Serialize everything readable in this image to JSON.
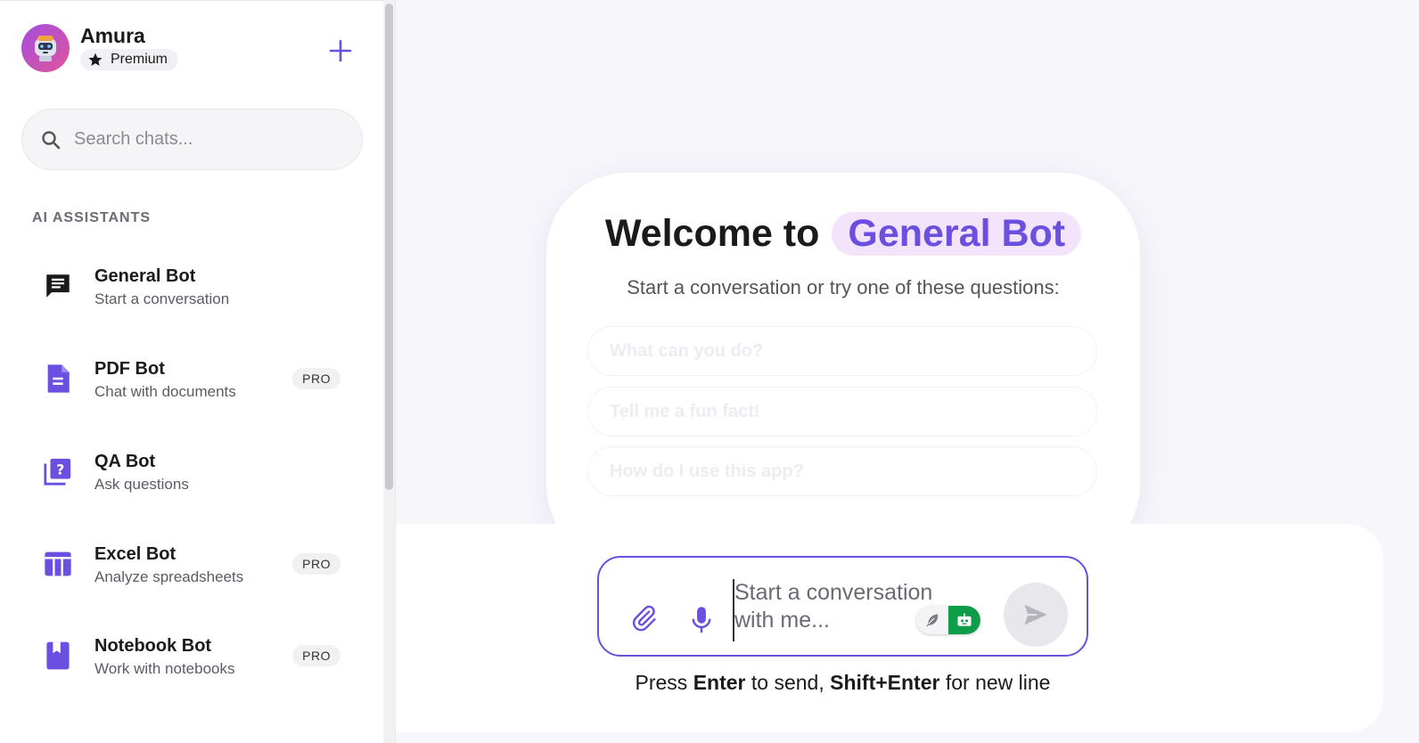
{
  "profile": {
    "name": "Amura",
    "plan": "Premium"
  },
  "search": {
    "placeholder": "Search chats..."
  },
  "assistants_section": {
    "title": "AI ASSISTANTS"
  },
  "assistants": [
    {
      "name": "General Bot",
      "description": "Start a conversation",
      "badge": "",
      "icon": "chat-icon"
    },
    {
      "name": "PDF Bot",
      "description": "Chat with documents",
      "badge": "PRO",
      "icon": "document-icon"
    },
    {
      "name": "QA Bot",
      "description": "Ask questions",
      "badge": "",
      "icon": "question-icon"
    },
    {
      "name": "Excel Bot",
      "description": "Analyze spreadsheets",
      "badge": "PRO",
      "icon": "table-icon"
    },
    {
      "name": "Notebook Bot",
      "description": "Work with notebooks",
      "badge": "PRO",
      "icon": "book-icon"
    }
  ],
  "welcome": {
    "prefix": "Welcome to",
    "bot_name": "General Bot",
    "subtitle": "Start a conversation or try one of these questions:",
    "suggestions": [
      "What can you do?",
      "Tell me a fun fact!",
      "How do I use this app?"
    ]
  },
  "composer": {
    "placeholder": "Start a conversation with me...",
    "hint_press": "Press",
    "hint_key1": "Enter",
    "hint_mid": "to send,",
    "hint_key2": "Shift+Enter",
    "hint_end": "for new line"
  },
  "colors": {
    "accent": "#6a4fe0",
    "toggle_active": "#0f9d4a",
    "badge_bg": "#f3e4fb"
  }
}
